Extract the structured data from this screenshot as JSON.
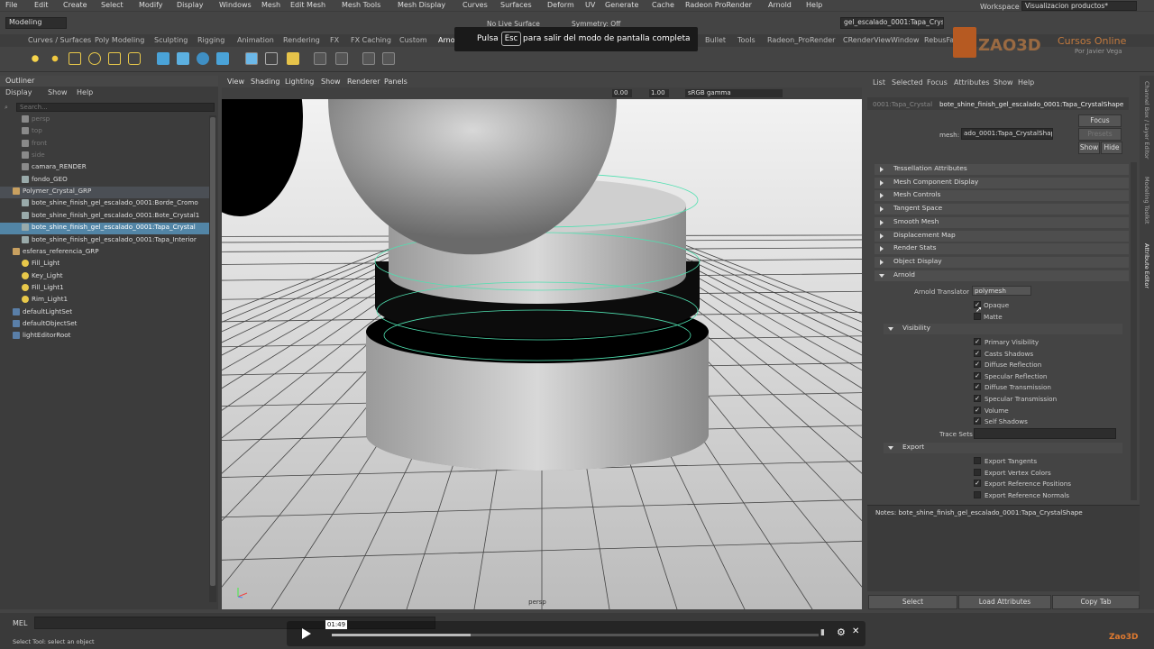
{
  "menu": [
    "File",
    "Edit",
    "Create",
    "Select",
    "Modify",
    "Display",
    "Windows",
    "Mesh",
    "Edit Mesh",
    "Mesh Tools",
    "Mesh Display",
    "Curves",
    "Surfaces",
    "Deform",
    "UV",
    "Generate",
    "Cache",
    "Radeon ProRender",
    "Arnold",
    "Help"
  ],
  "workspace_label": "Workspace :",
  "workspace_value": "Visualizacion productos*",
  "mode_select": "Modeling",
  "live_surface": "No Live Surface",
  "symmetry": "Symmetry: Off",
  "object_field": "gel_escalado_0001:Tapa_Crystal",
  "shelf_tabs": [
    "Curves / Surfaces",
    "Poly Modeling",
    "Sculpting",
    "Rigging",
    "Animation",
    "Rendering",
    "FX",
    "FX Caching",
    "Custom",
    "Arnol",
    "Bullet",
    "Tools",
    "Radeon_ProRender",
    "CRenderViewWindow",
    "RebusFarm"
  ],
  "fullscreen_notice": {
    "pre": "Pulsa",
    "key": "Esc",
    "post": "para salir del modo de pantalla completa"
  },
  "brand": {
    "name": "ZAO3D",
    "tag": "Cursos Online",
    "by": "Por Javier Vega"
  },
  "outliner": {
    "title": "Outliner",
    "menu": [
      "Display",
      "Show",
      "Help"
    ],
    "search_placeholder": "Search...",
    "items": [
      {
        "label": "persp",
        "indent": 24,
        "type": "cam",
        "state": "dim"
      },
      {
        "label": "top",
        "indent": 24,
        "type": "cam",
        "state": "dim"
      },
      {
        "label": "front",
        "indent": 24,
        "type": "cam",
        "state": "dim"
      },
      {
        "label": "side",
        "indent": 24,
        "type": "cam",
        "state": "dim"
      },
      {
        "label": "camara_RENDER",
        "indent": 24,
        "type": "cam",
        "state": ""
      },
      {
        "label": "fondo_GEO",
        "indent": 24,
        "type": "mesh",
        "state": ""
      },
      {
        "label": "Polymer_Crystal_GRP",
        "indent": 14,
        "type": "grp",
        "state": "grp"
      },
      {
        "label": "bote_shine_finish_gel_escalado_0001:Borde_Cromo",
        "indent": 24,
        "type": "mesh",
        "state": ""
      },
      {
        "label": "bote_shine_finish_gel_escalado_0001:Bote_Crystal1",
        "indent": 24,
        "type": "mesh",
        "state": ""
      },
      {
        "label": "bote_shine_finish_gel_escalado_0001:Tapa_Crystal",
        "indent": 24,
        "type": "mesh",
        "state": "sel"
      },
      {
        "label": "bote_shine_finish_gel_escalado_0001:Tapa_Interior",
        "indent": 24,
        "type": "mesh",
        "state": ""
      },
      {
        "label": "esferas_referencia_GRP",
        "indent": 14,
        "type": "grp",
        "state": ""
      },
      {
        "label": "Fill_Light",
        "indent": 24,
        "type": "light",
        "state": ""
      },
      {
        "label": "Key_Light",
        "indent": 24,
        "type": "light",
        "state": ""
      },
      {
        "label": "Fill_Light1",
        "indent": 24,
        "type": "light",
        "state": ""
      },
      {
        "label": "Rim_Light1",
        "indent": 24,
        "type": "light",
        "state": ""
      },
      {
        "label": "defaultLightSet",
        "indent": 14,
        "type": "set",
        "state": ""
      },
      {
        "label": "defaultObjectSet",
        "indent": 14,
        "type": "set",
        "state": ""
      },
      {
        "label": "lightEditorRoot",
        "indent": 14,
        "type": "set",
        "state": ""
      }
    ]
  },
  "viewport": {
    "menu": [
      "View",
      "Shading",
      "Lighting",
      "Show",
      "Renderer",
      "Panels"
    ],
    "field_a": "0.00",
    "field_b": "1.00",
    "colorspace": "sRGB gamma",
    "camera_label": "persp"
  },
  "attr_editor": {
    "menu": [
      "List",
      "Selected",
      "Focus",
      "Attributes",
      "Show",
      "Help"
    ],
    "tab_a": "0001:Tapa_Crystal",
    "tab_b": "bote_shine_finish_gel_escalado_0001:Tapa_CrystalShape",
    "mesh_label": "mesh:",
    "mesh_value": "ado_0001:Tapa_CrystalShape",
    "focus": "Focus",
    "presets": "Presets",
    "show": "Show",
    "hide": "Hide",
    "sections": [
      "Tessellation Attributes",
      "Mesh Component Display",
      "Mesh Controls",
      "Tangent Space",
      "Smooth Mesh",
      "Displacement Map",
      "Render Stats",
      "Object Display",
      "Arnold"
    ],
    "translator_label": "Arnold Translator",
    "translator_value": "polymesh",
    "opaque": "Opaque",
    "matte": "Matte",
    "visibility": "Visibility",
    "vis_items": [
      "Primary Visibility",
      "Casts Shadows",
      "Diffuse Reflection",
      "Specular Reflection",
      "Diffuse Transmission",
      "Specular Transmission",
      "Volume",
      "Self Shadows"
    ],
    "trace_sets": "Trace Sets",
    "export": "Export",
    "export_items": [
      {
        "label": "Export Tangents",
        "checked": false
      },
      {
        "label": "Export Vertex Colors",
        "checked": false
      },
      {
        "label": "Export Reference Positions",
        "checked": true
      },
      {
        "label": "Export Reference Normals",
        "checked": false
      }
    ],
    "notes": "Notes:  bote_shine_finish_gel_escalado_0001:Tapa_CrystalShape",
    "buttons": [
      "Select",
      "Load Attributes",
      "Copy Tab"
    ]
  },
  "side_tabs": [
    "Channel Box / Layer Editor",
    "Modeling Toolkit",
    "Attribute Editor"
  ],
  "command": {
    "lang": "MEL",
    "help": "Select Tool: select an object"
  },
  "player": {
    "time": "01:49",
    "progress": 0.285
  },
  "watermark": "Zao3D"
}
